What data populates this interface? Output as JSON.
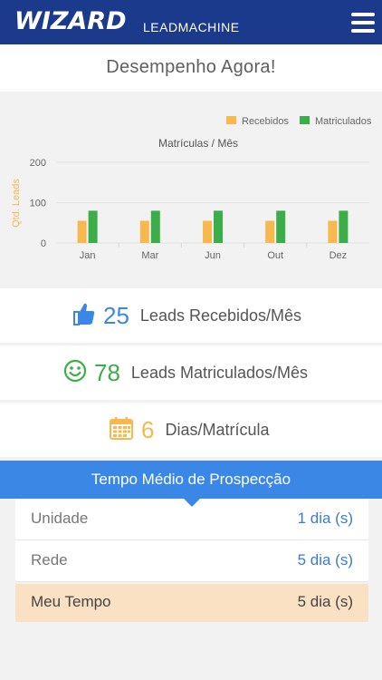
{
  "header": {
    "logo": "WIZARD",
    "subtitle": "LEADMACHINE",
    "menu_icon": "hamburger-icon"
  },
  "hero": {
    "title": "Desempenho Agora!"
  },
  "chart_data": {
    "type": "bar",
    "title": "Matrículas / Mês",
    "ylabel": "Qtd. Leads",
    "xlabel": "",
    "categories": [
      "Jan",
      "Mar",
      "Jun",
      "Out",
      "Dez"
    ],
    "series": [
      {
        "name": "Recebidos",
        "color": "#f7b84e",
        "values": [
          55,
          55,
          55,
          55,
          55
        ]
      },
      {
        "name": "Matriculados",
        "color": "#3cae49",
        "values": [
          80,
          80,
          80,
          80,
          80
        ]
      }
    ],
    "yticks": [
      "0",
      "100",
      "200"
    ],
    "ylim": [
      0,
      200
    ],
    "legend": "top-right",
    "grid": true
  },
  "stats": [
    {
      "icon": "thumbs-up-icon",
      "value": "25",
      "label": "Leads Recebidos/Mês",
      "color": "#3a87e6"
    },
    {
      "icon": "smiley-icon",
      "value": "78",
      "label": "Leads Matriculados/Mês",
      "color": "#3cae49"
    },
    {
      "icon": "calendar-icon",
      "value": "6",
      "label": "Dias/Matrícula",
      "color": "#f7b84e"
    }
  ],
  "prospect": {
    "title": "Tempo Médio de Prospecção",
    "rows": [
      {
        "label": "Unidade",
        "value": "1 dia (s)"
      },
      {
        "label": "Rede",
        "value": "5 dia (s)"
      },
      {
        "label": "Meu Tempo",
        "value": "5 dia (s)"
      }
    ]
  }
}
